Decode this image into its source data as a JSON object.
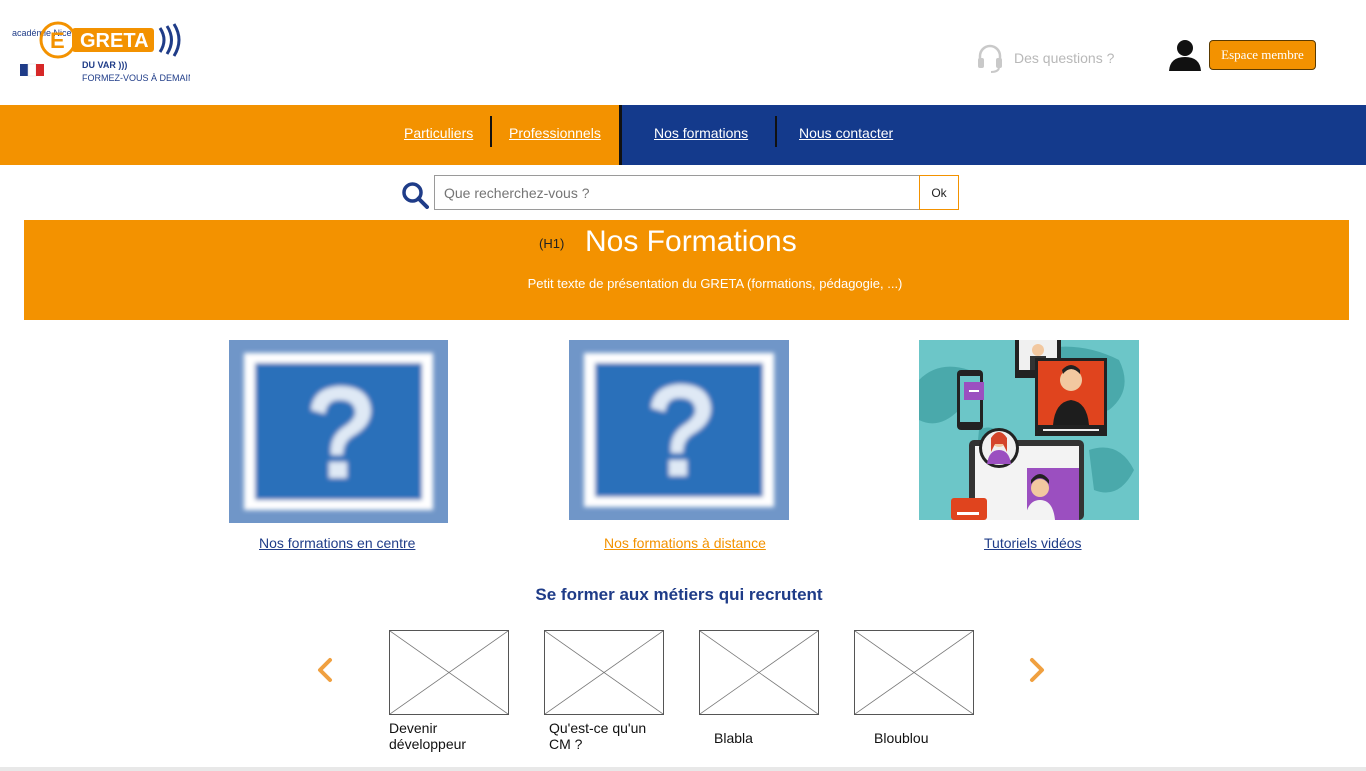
{
  "header": {
    "logo": {
      "academie_text": "académie Nice",
      "brand": "GRETA",
      "tagline_line1": "DU VAR )))",
      "tagline_line2": "FORMEZ-VOUS À DEMAIN"
    },
    "questions_label": "Des questions ?",
    "member_button": "Espace membre"
  },
  "nav": {
    "items": [
      {
        "label": "Particuliers"
      },
      {
        "label": "Professionnels"
      },
      {
        "label": "Nos formations"
      },
      {
        "label": "Nous contacter"
      }
    ]
  },
  "search": {
    "placeholder": "Que recherchez-vous ?",
    "button": "Ok"
  },
  "banner": {
    "tag": "(H1)",
    "title": "Nos Formations",
    "subtitle": "Petit texte de présentation du GRETA (formations, pédagogie, ...)"
  },
  "cards": [
    {
      "label": "Nos formations en centre"
    },
    {
      "label": "Nos formations à distance"
    },
    {
      "label": "Tutoriels vidéos"
    }
  ],
  "section": {
    "title": "Se former aux métiers qui recrutent"
  },
  "carousel": {
    "items": [
      {
        "line1": "Devenir",
        "line2": "développeur"
      },
      {
        "line1": "Qu'est-ce qu'un",
        "line2": "CM ?"
      },
      {
        "line1": "Blabla",
        "line2": ""
      },
      {
        "line1": "Bloublou",
        "line2": ""
      }
    ]
  },
  "colors": {
    "orange": "#f39200",
    "blue": "#143a8c",
    "title_blue": "#1f3c88"
  }
}
